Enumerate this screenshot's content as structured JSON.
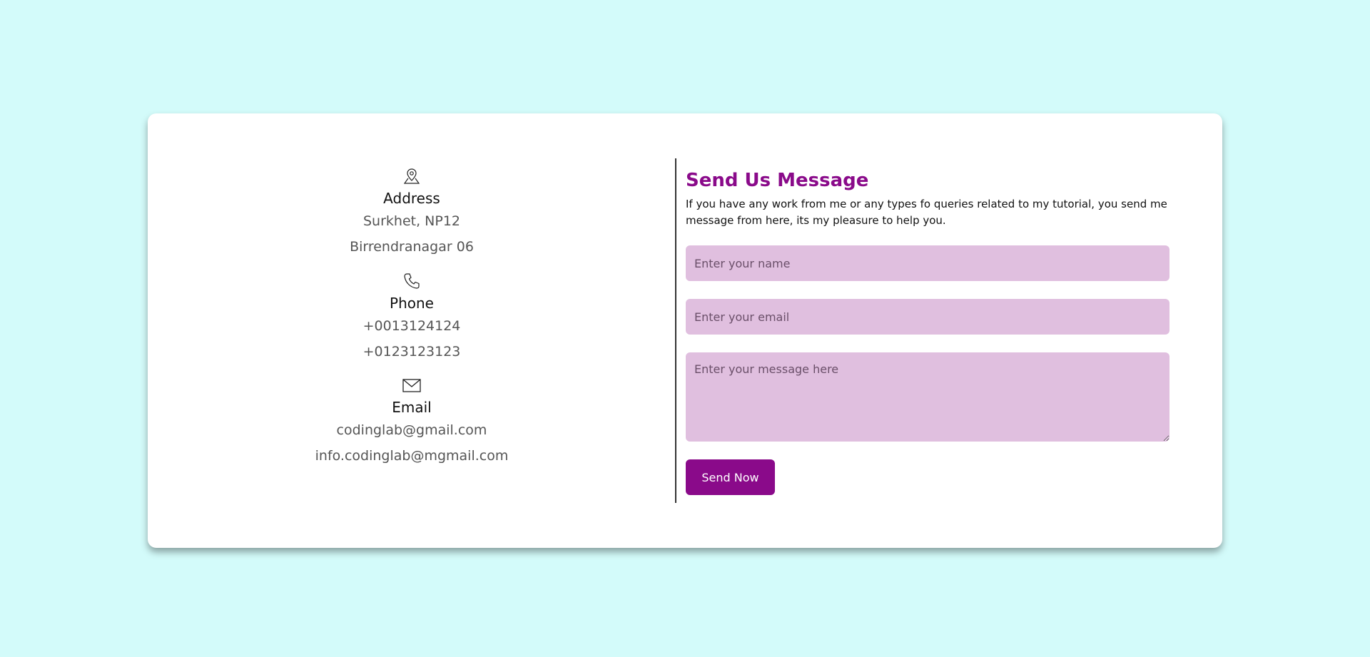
{
  "theme": {
    "page_background": "#d3fbfa",
    "accent": "#8a0a8a",
    "field_background": "#e0bfdf"
  },
  "contact_info": {
    "address": {
      "icon": "map-pin-icon",
      "title": "Address",
      "lines": [
        "Surkhet, NP12",
        "Birrendranagar 06"
      ]
    },
    "phone": {
      "icon": "phone-icon",
      "title": "Phone",
      "lines": [
        "+0013124124",
        "+0123123123"
      ]
    },
    "email": {
      "icon": "envelope-icon",
      "title": "Email",
      "lines": [
        "codinglab@gmail.com",
        "info.codinglab@mgmail.com"
      ]
    }
  },
  "form": {
    "heading": "Send Us Message",
    "description": "If you have any work from me or any types fo queries related to my tutorial, you send me message from here, its my pleasure to help you.",
    "name_placeholder": "Enter your name",
    "email_placeholder": "Enter your email",
    "message_placeholder": "Enter your message here",
    "submit_label": "Send Now"
  }
}
